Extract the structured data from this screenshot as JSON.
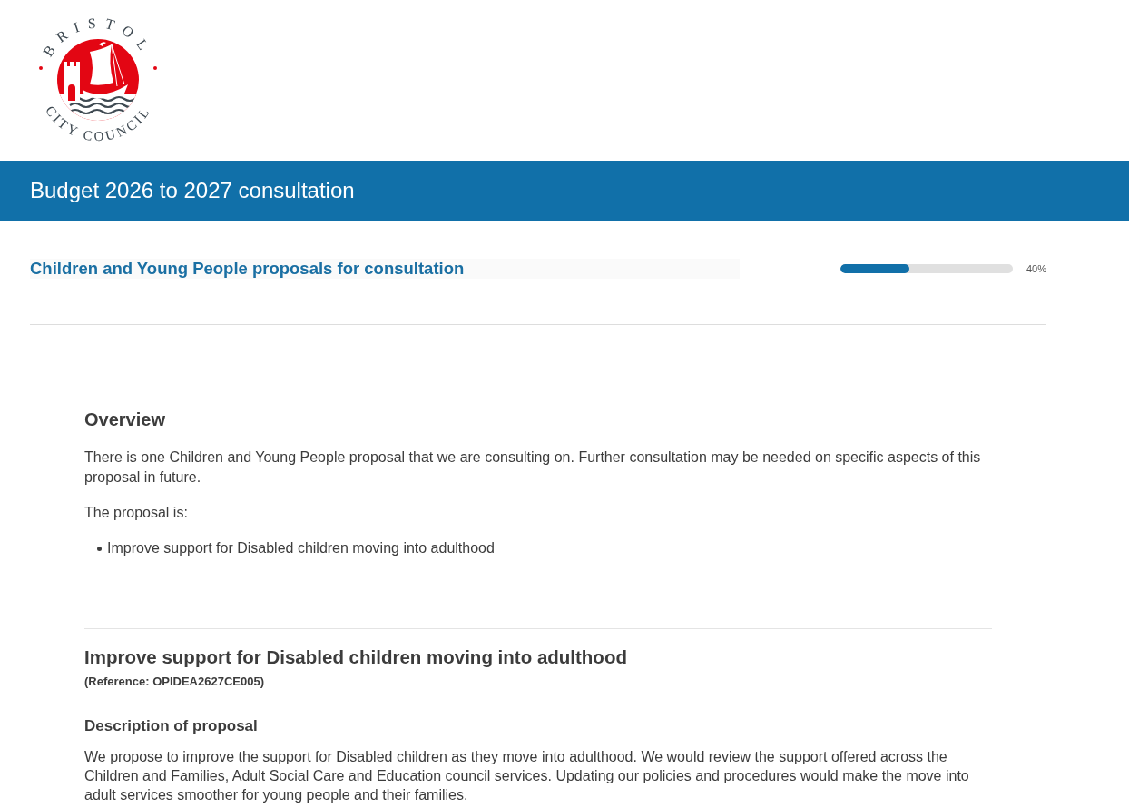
{
  "logo": {
    "top_text": "BRISTOL",
    "bottom_text": "CITY COUNCIL"
  },
  "header": {
    "title": "Budget 2026 to 2027 consultation"
  },
  "page": {
    "title": "Children and Young People proposals for consultation",
    "progress": {
      "level": 0.4,
      "reading": "40%"
    }
  },
  "overview": {
    "heading": "Overview",
    "paragraphs": [
      "There is one Children and Young People proposal that we are consulting on. Further consultation may be needed on specific aspects of this proposal in future.",
      "The proposal is:"
    ],
    "list": [
      "Improve support for Disabled children moving into adulthood"
    ]
  },
  "proposal": {
    "title": "Improve support for Disabled children moving into adulthood",
    "reference": "(Reference: OPIDEA2627CE005)",
    "sections": [
      {
        "heading": "Description of proposal",
        "text": "We propose to improve the support for Disabled children as they move into adulthood. We would review the support offered across the Children and Families, Adult Social Care and Education council services. Updating our policies and procedures would make the move into adult services smoother for young people and their families."
      }
    ]
  }
}
